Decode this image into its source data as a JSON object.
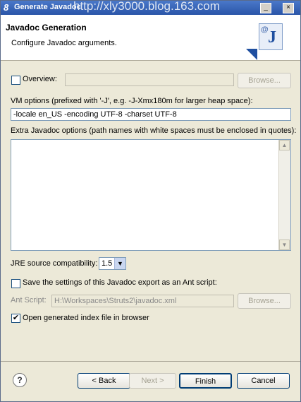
{
  "window": {
    "title": "Generate Javadoc",
    "watermark": "http://xly3000.blog.163.com",
    "min_glyph": "_",
    "close_glyph": "×"
  },
  "header": {
    "title": "Javadoc Generation",
    "subtitle": "Configure Javadoc arguments."
  },
  "overview": {
    "label": "Overview:",
    "checked": false,
    "value": "",
    "browse_label": "Browse..."
  },
  "vm_options": {
    "label": "VM options (prefixed with '-J', e.g. -J-Xmx180m for larger heap space):",
    "value": "-locale en_US -encoding UTF-8 -charset UTF-8"
  },
  "extra_options": {
    "label": "Extra Javadoc options (path names with white spaces must be enclosed in quotes):",
    "value": ""
  },
  "jre": {
    "label": "JRE source compatibility:",
    "value": "1.5"
  },
  "ant": {
    "save_label": "Save the settings of this Javadoc export as an Ant script:",
    "save_checked": false,
    "script_label": "Ant Script:",
    "script_value": "H:\\Workspaces\\Struts2\\javadoc.xml",
    "browse_label": "Browse..."
  },
  "open_index": {
    "label": "Open generated index file in browser",
    "checked": true
  },
  "footer": {
    "help_glyph": "?",
    "back_label": "< Back",
    "next_label": "Next >",
    "finish_label": "Finish",
    "cancel_label": "Cancel"
  },
  "icons": {
    "help": "help-icon",
    "javadoc": "javadoc-wizard-icon",
    "check": "✔"
  }
}
